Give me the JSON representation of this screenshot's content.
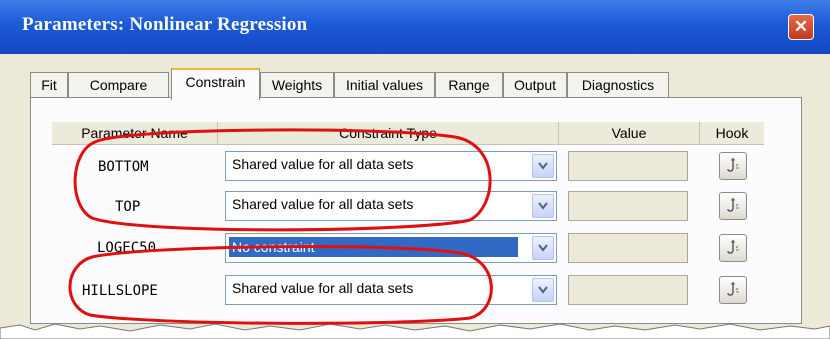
{
  "window": {
    "title": "Parameters: Nonlinear Regression",
    "close_glyph": "✕"
  },
  "tabs": [
    {
      "label": "Fit"
    },
    {
      "label": "Compare"
    },
    {
      "label": "Constrain"
    },
    {
      "label": "Weights"
    },
    {
      "label": "Initial values"
    },
    {
      "label": "Range"
    },
    {
      "label": "Output"
    },
    {
      "label": "Diagnostics"
    }
  ],
  "active_tab": "Constrain",
  "table": {
    "headers": {
      "name": "Parameter Name",
      "type": "Constraint Type",
      "value": "Value",
      "hook": "Hook"
    },
    "rows": [
      {
        "name": "BOTTOM",
        "constraint": "Shared value for all data sets",
        "value": ""
      },
      {
        "name": "TOP",
        "constraint": "Shared value for all data sets",
        "value": ""
      },
      {
        "name": "LOGEC50",
        "constraint": "No constraint",
        "value": ""
      },
      {
        "name": "HILLSLOPE",
        "constraint": "Shared value for all data sets",
        "value": ""
      }
    ]
  },
  "icons": {
    "dropdown": "chevron-down-icon",
    "hook": "hook-icon",
    "close": "close-icon"
  },
  "colors": {
    "titlebar": "#1c5ad6",
    "highlight": "#316ac5",
    "annotation": "#e01010",
    "dialog": "#ece9d8"
  }
}
